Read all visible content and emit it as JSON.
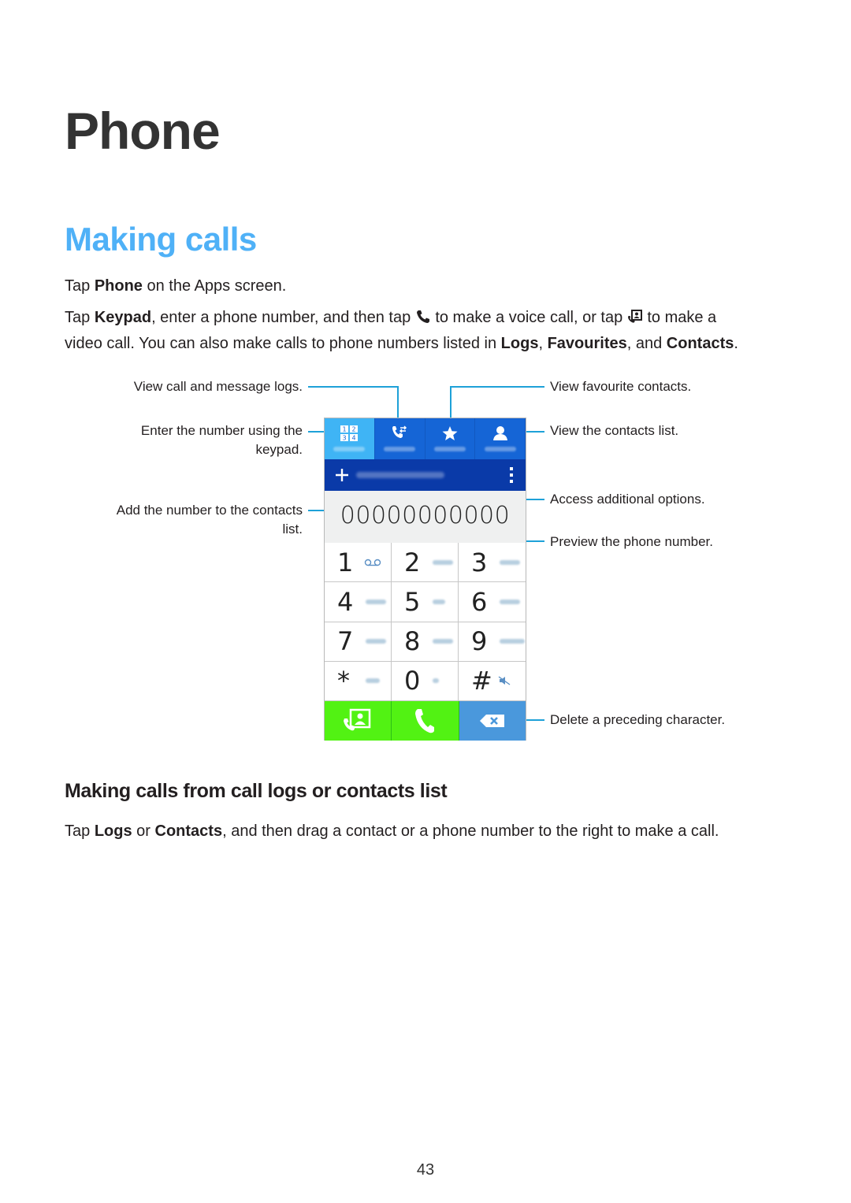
{
  "page": {
    "title": "Phone",
    "section_title": "Making calls",
    "page_number": "43"
  },
  "intro": {
    "line1": {
      "pre": "Tap ",
      "bold": "Phone",
      "post": " on the Apps screen."
    },
    "line2": {
      "t1": "Tap ",
      "b1": "Keypad",
      "t2": ", enter a phone number, and then tap ",
      "icon1": "phone-handset-icon",
      "t3": " to make a voice call, or tap ",
      "icon2": "video-call-icon",
      "t4": " to make a",
      "t5": "video call. You can also make calls to phone numbers listed in ",
      "b2": "Logs",
      "t6": ", ",
      "b3": "Favourites",
      "t7": ", and ",
      "b4": "Contacts",
      "t8": "."
    }
  },
  "callouts": {
    "logs": "View call and message logs.",
    "keypad_line1": "Enter the number using the",
    "keypad_line2": "keypad.",
    "add_line1": "Add the number to the contacts",
    "add_line2": "list.",
    "favourites": "View favourite contacts.",
    "contacts": "View the contacts list.",
    "options": "Access additional options.",
    "preview": "Preview the phone number.",
    "delete": "Delete a preceding character."
  },
  "phone_screen": {
    "tabs": [
      {
        "icon": "keypad-icon",
        "active": true
      },
      {
        "icon": "logs-icon",
        "active": false
      },
      {
        "icon": "star-icon",
        "active": false
      },
      {
        "icon": "contact-icon",
        "active": false
      }
    ],
    "number": "00000000000",
    "keys": [
      "1",
      "2",
      "3",
      "4",
      "5",
      "6",
      "7",
      "8",
      "9",
      "*",
      "0",
      "#"
    ],
    "colors": {
      "tab_active": "#3fb4f5",
      "tab": "#1565d6",
      "action_bar": "#0a3aa8",
      "call_button": "#52f213",
      "delete_button": "#4a98dc",
      "accent_heading": "#4fb1f7",
      "callout_line": "#1ea1d8"
    }
  },
  "subsection": {
    "title": "Making calls from call logs or contacts list",
    "body": {
      "t1": "Tap ",
      "b1": "Logs",
      "t2": " or ",
      "b2": "Contacts",
      "t3": ", and then drag a contact or a phone number to the right to make a call."
    }
  }
}
